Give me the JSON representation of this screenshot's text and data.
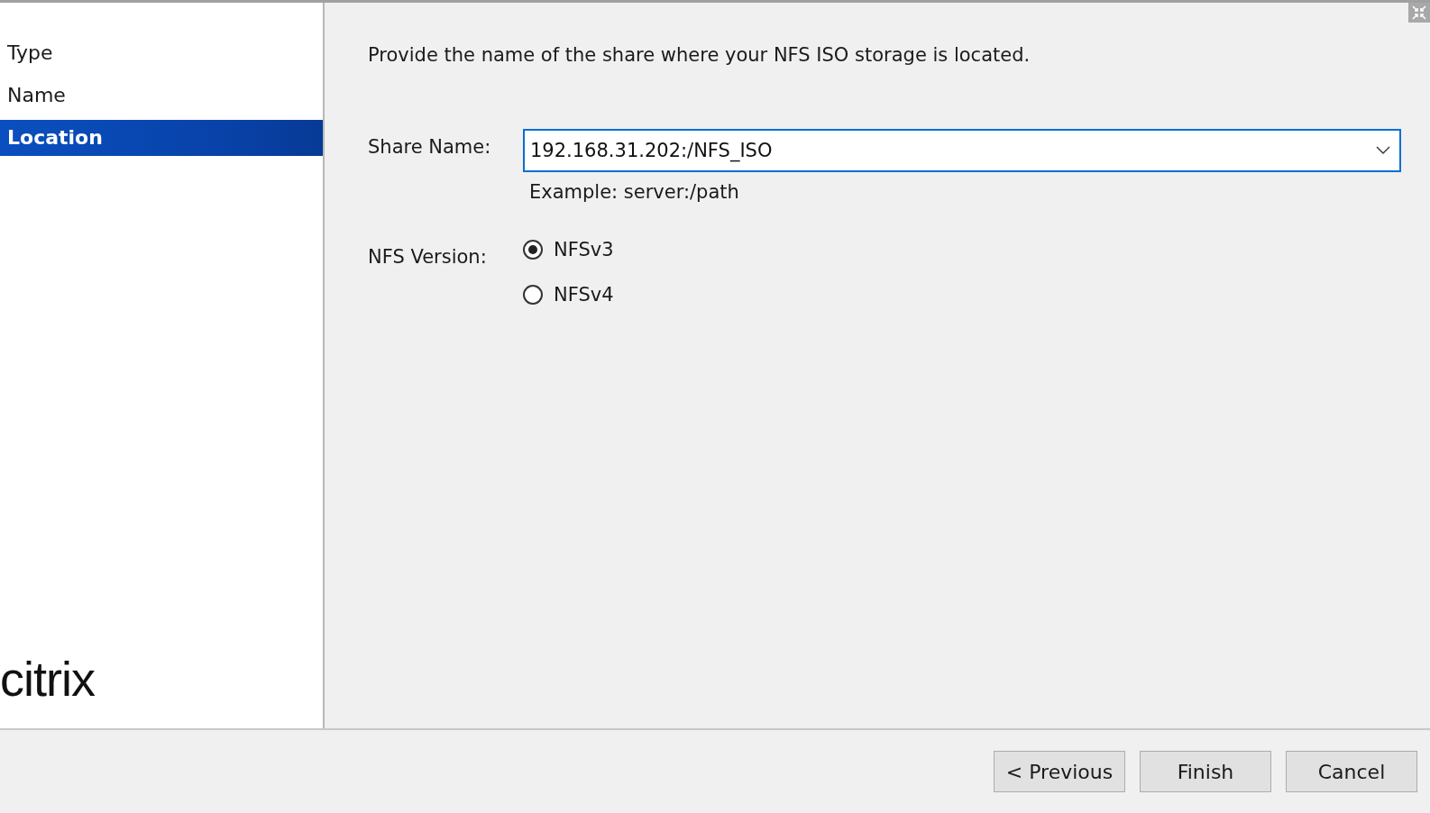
{
  "sidebar": {
    "items": [
      {
        "label": "Type",
        "selected": false
      },
      {
        "label": "Name",
        "selected": false
      },
      {
        "label": "Location",
        "selected": true
      }
    ],
    "logo": "citrix"
  },
  "content": {
    "instruction": "Provide the name of the share where your NFS ISO storage is located.",
    "share_name": {
      "label": "Share Name:",
      "value": "192.168.31.202:/NFS_ISO",
      "hint": "Example: server:/path"
    },
    "nfs_version": {
      "label": "NFS Version:",
      "options": [
        {
          "label": "NFSv3",
          "selected": true
        },
        {
          "label": "NFSv4",
          "selected": false
        }
      ]
    }
  },
  "buttons": [
    {
      "label": "< Previous"
    },
    {
      "label": "Finish"
    },
    {
      "label": "Cancel"
    }
  ]
}
